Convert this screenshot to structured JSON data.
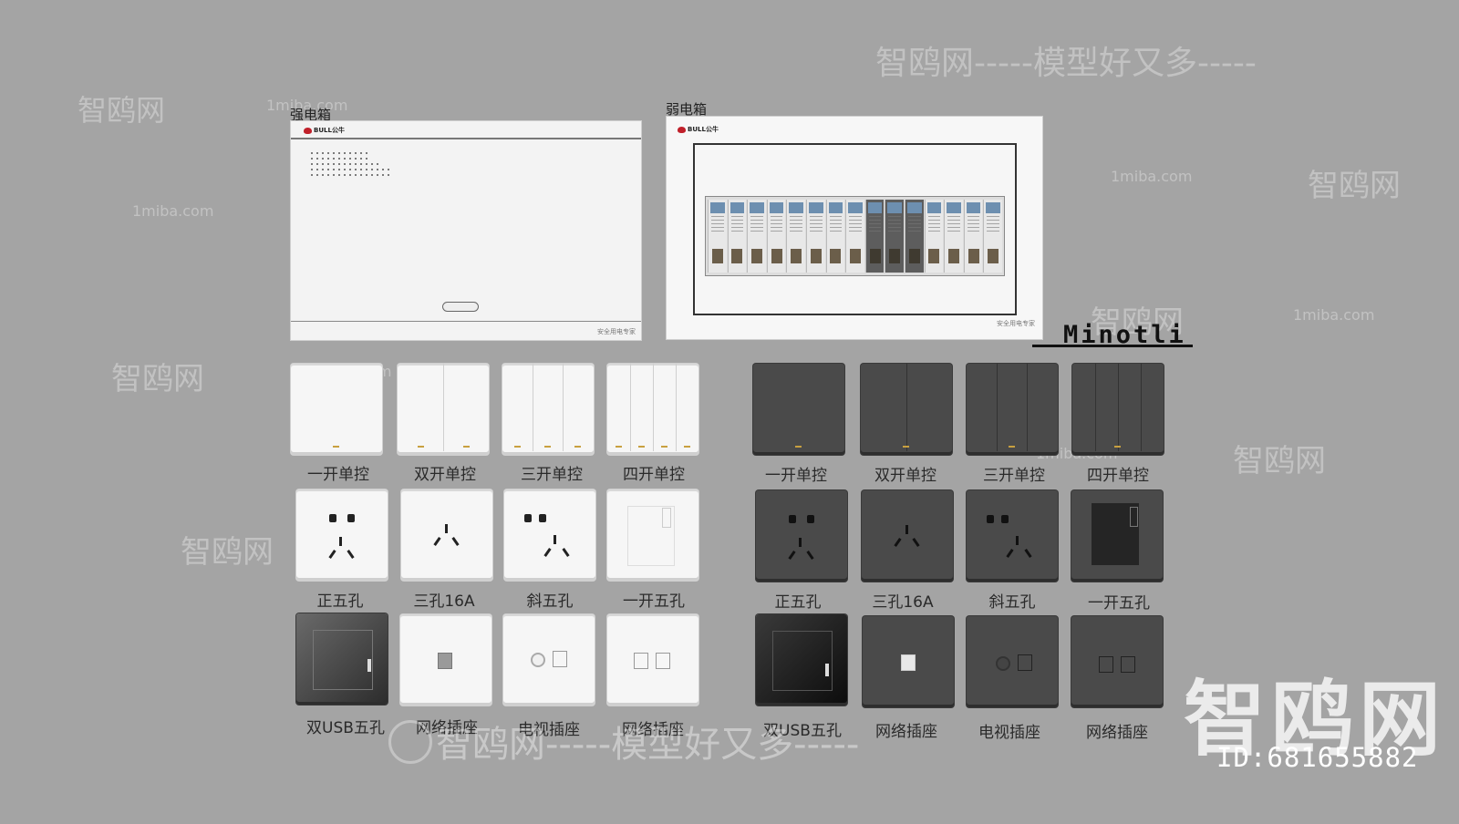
{
  "boxes": {
    "strong": {
      "label": "强电箱",
      "brand": "BULL公牛",
      "slogan": "安全用电专家"
    },
    "weak": {
      "label": "弱电箱",
      "brand": "BULL公牛",
      "slogan": "安全用电专家"
    }
  },
  "brand_series": "Minotli",
  "white_set": {
    "switches": [
      "一开单控",
      "双开单控",
      "三开单控",
      "四开单控"
    ],
    "sockets": [
      "正五孔",
      "三孔16A",
      "斜五孔",
      "一开五孔"
    ],
    "data_sockets": [
      "双USB五孔",
      "网络插座",
      "电视插座",
      "网络插座"
    ]
  },
  "dark_set": {
    "switches": [
      "一开单控",
      "双开单控",
      "三开单控",
      "四开单控"
    ],
    "sockets": [
      "正五孔",
      "三孔16A",
      "斜五孔",
      "一开五孔"
    ],
    "data_sockets": [
      "双USB五孔",
      "网络插座",
      "电视插座",
      "网络插座"
    ]
  },
  "watermark": {
    "site_cn": "智鸥网",
    "site_en": "1miba.com",
    "slogan": "智鸥网-----模型好又多-----",
    "big": "智鸥网",
    "id": "ID:681655882"
  },
  "colors": {
    "background": "#a4a4a4",
    "indicator": "#c8a040",
    "dark_plate": "#4a4a4a",
    "white_plate": "#f6f6f6"
  }
}
